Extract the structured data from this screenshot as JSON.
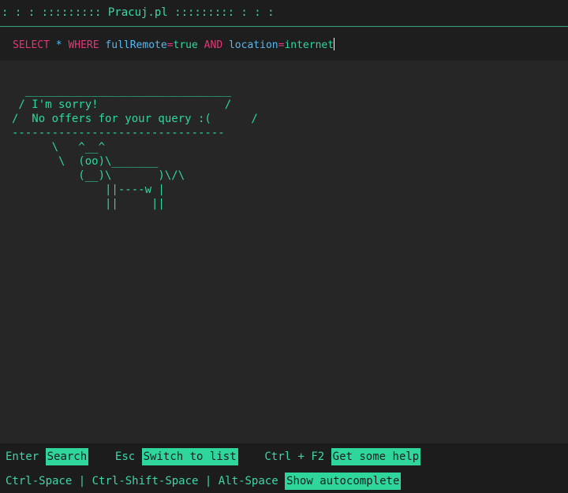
{
  "titlebar": {
    "text": ": : : ::::::::: Pracuj.pl ::::::::: : : :"
  },
  "query": {
    "select_kw": "SELECT",
    "star": "*",
    "where_kw": "WHERE",
    "field1": "fullRemote",
    "eq1": "=",
    "value1": "true",
    "and_kw": "AND",
    "field2": "location",
    "eq2": "=",
    "value2": "internet"
  },
  "result": {
    "ascii_art": "  _______________________________\n / I'm sorry!                   /\n/  No offers for your query :(      /\n--------------------------------\n      \\   ^__^\n       \\  (oo)\\_______\n          (__)\\       )\\/\\\n              ||----w |\n              ||     ||"
  },
  "footer": {
    "row1": [
      {
        "key": "Enter",
        "action": "Search"
      },
      {
        "key": "Esc",
        "action": "Switch to list"
      },
      {
        "key": "Ctrl + F2",
        "action": "Get some help"
      }
    ],
    "row2": {
      "keys": [
        "Ctrl-Space",
        "Ctrl-Shift-Space",
        "Alt-Space"
      ],
      "separator": "|",
      "action": "Show autocomplete"
    }
  },
  "colors": {
    "accent": "#2fd69c",
    "keyword": "#e8347a",
    "field": "#58b8f0",
    "background": "#262626"
  }
}
